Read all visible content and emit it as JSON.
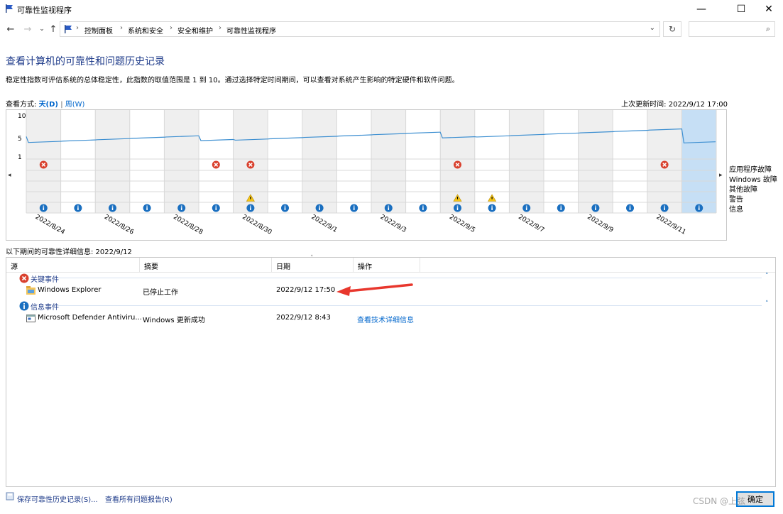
{
  "window": {
    "title": "可靠性监视程序",
    "minimize": "—",
    "maximize": "☐",
    "close": "✕"
  },
  "nav": {
    "back_icon": "arrow-left",
    "forward_icon": "arrow-right",
    "recent_icon": "chevron-down",
    "up_icon": "arrow-up"
  },
  "breadcrumb": [
    "控制面板",
    "系统和安全",
    "安全和维护",
    "可靠性监视程序"
  ],
  "search": {
    "placeholder": ""
  },
  "page": {
    "heading": "查看计算机的可靠性和问题历史记录",
    "description": "稳定性指数可评估系统的总体稳定性，此指数的取值范围是 1 到 10。通过选择特定时间期间，可以查看对系统产生影响的特定硬件和软件问题。",
    "view_by_label": "查看方式:",
    "view_day": "天(D)",
    "view_sep": "|",
    "view_week": "周(W)",
    "last_updated": "上次更新时间: 2022/9/12 17:00"
  },
  "chart_data": {
    "type": "line",
    "y_ticks": [
      "10",
      "5",
      "1"
    ],
    "ylim": [
      1,
      10
    ],
    "date_labels": [
      "2022/8/24",
      "2022/8/26",
      "2022/8/28",
      "2022/8/30",
      "2022/9/1",
      "2022/9/3",
      "2022/9/5",
      "2022/9/7",
      "2022/9/9",
      "2022/9/11"
    ],
    "days": [
      "2022/8/24",
      "2022/8/25",
      "2022/8/26",
      "2022/8/27",
      "2022/8/28",
      "2022/8/29",
      "2022/8/30",
      "2022/8/31",
      "2022/9/1",
      "2022/9/2",
      "2022/9/3",
      "2022/9/4",
      "2022/9/5",
      "2022/9/6",
      "2022/9/7",
      "2022/9/8",
      "2022/9/9",
      "2022/9/10",
      "2022/9/11",
      "2022/9/12"
    ],
    "stability_start": {
      "date": "2022/8/23",
      "value": 5.3
    },
    "stability_index": [
      4.0,
      4.3,
      4.6,
      4.9,
      5.2,
      4.4,
      4.5,
      4.8,
      5.1,
      5.4,
      5.7,
      6.0,
      5.0,
      5.2,
      5.5,
      5.8,
      6.1,
      6.4,
      6.7,
      3.9
    ],
    "categories": [
      "应用程序故障",
      "Windows 故障",
      "其他故障",
      "警告",
      "信息"
    ],
    "app_failure_days": [
      "2022/8/24",
      "2022/8/29",
      "2022/8/30",
      "2022/9/5",
      "2022/9/11"
    ],
    "warning_days": [
      "2022/8/30",
      "2022/9/5",
      "2022/9/6"
    ],
    "info_days": [
      "2022/8/24",
      "2022/8/25",
      "2022/8/26",
      "2022/8/27",
      "2022/8/28",
      "2022/8/29",
      "2022/8/30",
      "2022/8/31",
      "2022/9/1",
      "2022/9/2",
      "2022/9/3",
      "2022/9/4",
      "2022/9/5",
      "2022/9/6",
      "2022/9/7",
      "2022/9/8",
      "2022/9/9",
      "2022/9/10",
      "2022/9/11",
      "2022/9/12"
    ],
    "selected_day": "2022/9/12",
    "colors": {
      "line": "#3d8fd1",
      "grid": "#d8d8d8",
      "shade": "#efefef",
      "selected": "#c6dff5",
      "error": "#d9412e",
      "warning": "#f5c518",
      "info": "#1a6fc0"
    }
  },
  "details": {
    "label": "以下期间的可靠性详细信息: 2022/9/12",
    "columns": [
      "源",
      "摘要",
      "日期",
      "操作"
    ],
    "groups": [
      {
        "title": "关键事件",
        "icon": "error-icon",
        "rows": [
          {
            "source": "Windows Explorer",
            "summary": "已停止工作",
            "date": "2022/9/12 17:50",
            "action": ""
          }
        ]
      },
      {
        "title": "信息事件",
        "icon": "info-icon",
        "rows": [
          {
            "source": "Microsoft Defender Antiviru...",
            "summary": "Windows 更新成功",
            "date": "2022/9/12 8:43",
            "action": "查看技术详细信息"
          }
        ]
      }
    ]
  },
  "footer": {
    "save_link": "保存可靠性历史记录(S)...",
    "view_all_link": "查看所有问题报告(R)",
    "ok_button": "确定",
    "watermark": "CSDN @上弦"
  }
}
